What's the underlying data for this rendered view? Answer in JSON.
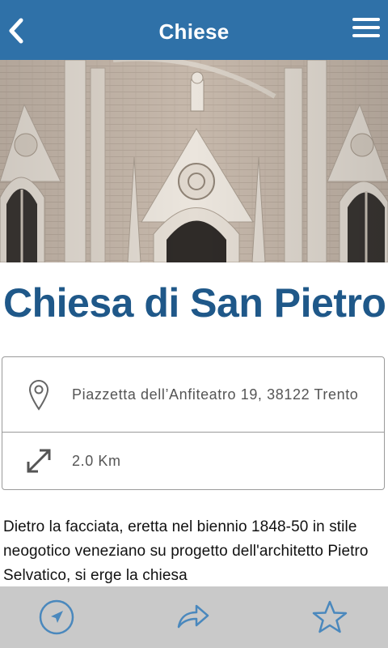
{
  "header": {
    "title": "Chiese",
    "back_icon": "chevron-left-icon",
    "menu_icon": "hamburger-menu-icon",
    "background_color": "#2f71a8"
  },
  "hero": {
    "image": "church-facade-photo"
  },
  "place": {
    "title": "Chiesa di San Pietro",
    "title_color": "#1f5889",
    "address": "Piazzetta dell’Anfiteatro 19, 38122 Trento",
    "distance": "2.0 Km",
    "address_icon": "map-pin-icon",
    "distance_icon": "diagonal-arrows-icon"
  },
  "description": "Dietro la facciata, eretta nel biennio 1848-50 in stile neogotico veneziano su progetto dell'architetto Pietro Selvatico, si erge la chiesa",
  "bottombar": {
    "navigate_icon": "navigation-icon",
    "share_icon": "share-icon",
    "favorite_icon": "star-icon",
    "background_color": "#c9c9c9",
    "icon_color": "#4a88bd"
  }
}
